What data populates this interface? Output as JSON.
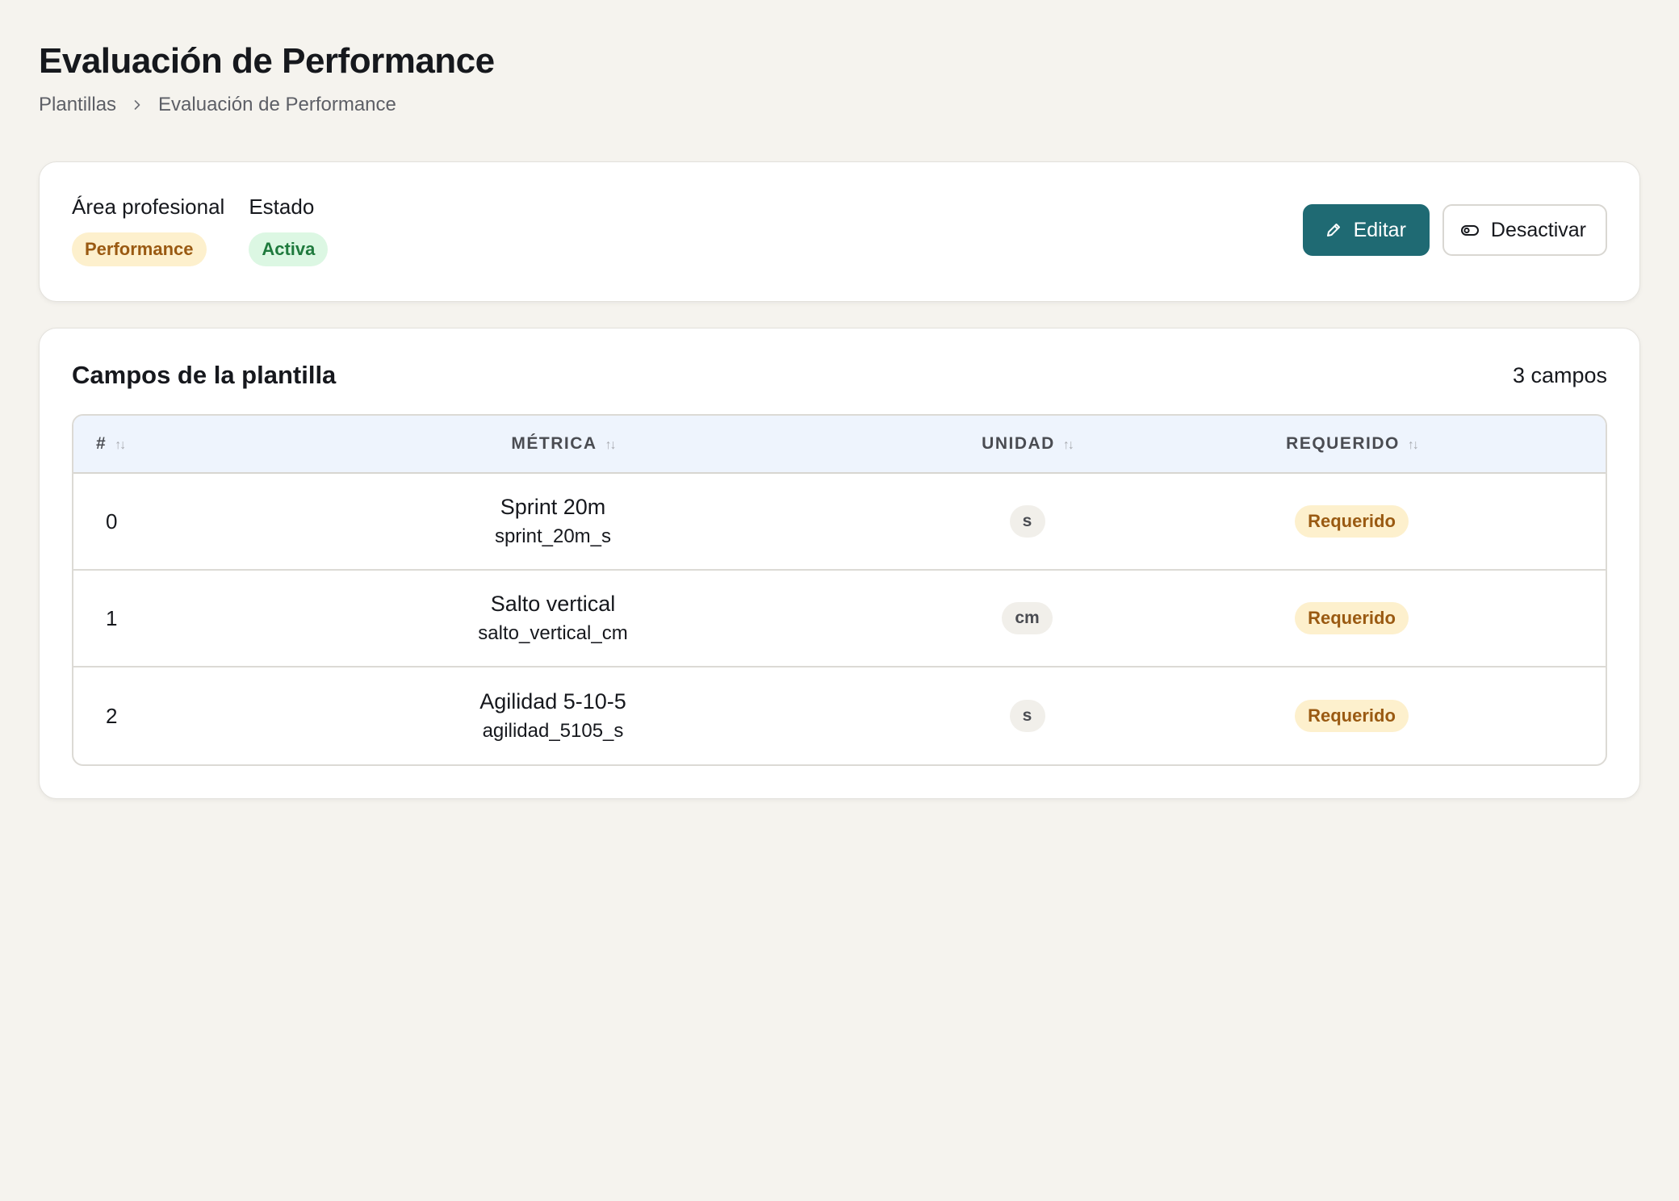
{
  "page": {
    "title": "Evaluación de Performance"
  },
  "breadcrumb": {
    "items": [
      "Plantillas",
      "Evaluación de Performance"
    ]
  },
  "summary": {
    "area_label": "Área profesional",
    "area_value": "Performance",
    "state_label": "Estado",
    "state_value": "Activa",
    "edit_label": "Editar",
    "deactivate_label": "Desactivar"
  },
  "fields": {
    "title": "Campos de la plantilla",
    "count": "3 campos",
    "columns": {
      "num": "#",
      "metric": "MÉTRICA",
      "unit": "UNIDAD",
      "required": "REQUERIDO"
    },
    "rows": [
      {
        "num": "0",
        "name": "Sprint 20m",
        "key": "sprint_20m_s",
        "unit": "s",
        "required": "Requerido"
      },
      {
        "num": "1",
        "name": "Salto vertical",
        "key": "salto_vertical_cm",
        "unit": "cm",
        "required": "Requerido"
      },
      {
        "num": "2",
        "name": "Agilidad 5-10-5",
        "key": "agilidad_5105_s",
        "unit": "s",
        "required": "Requerido"
      }
    ]
  },
  "colors": {
    "background": "#f5f3ee",
    "primary": "#1f6a73",
    "area_badge_bg": "#fdf0cd",
    "area_badge_text": "#9a5a12",
    "state_badge_bg": "#dcf7e3",
    "state_badge_text": "#1f7a3d",
    "table_header_bg": "#eef4fd"
  },
  "icons": {
    "breadcrumb_separator": "chevron-right-icon",
    "edit": "pencil-icon",
    "deactivate": "toggle-icon",
    "sort": "sort-icon"
  }
}
